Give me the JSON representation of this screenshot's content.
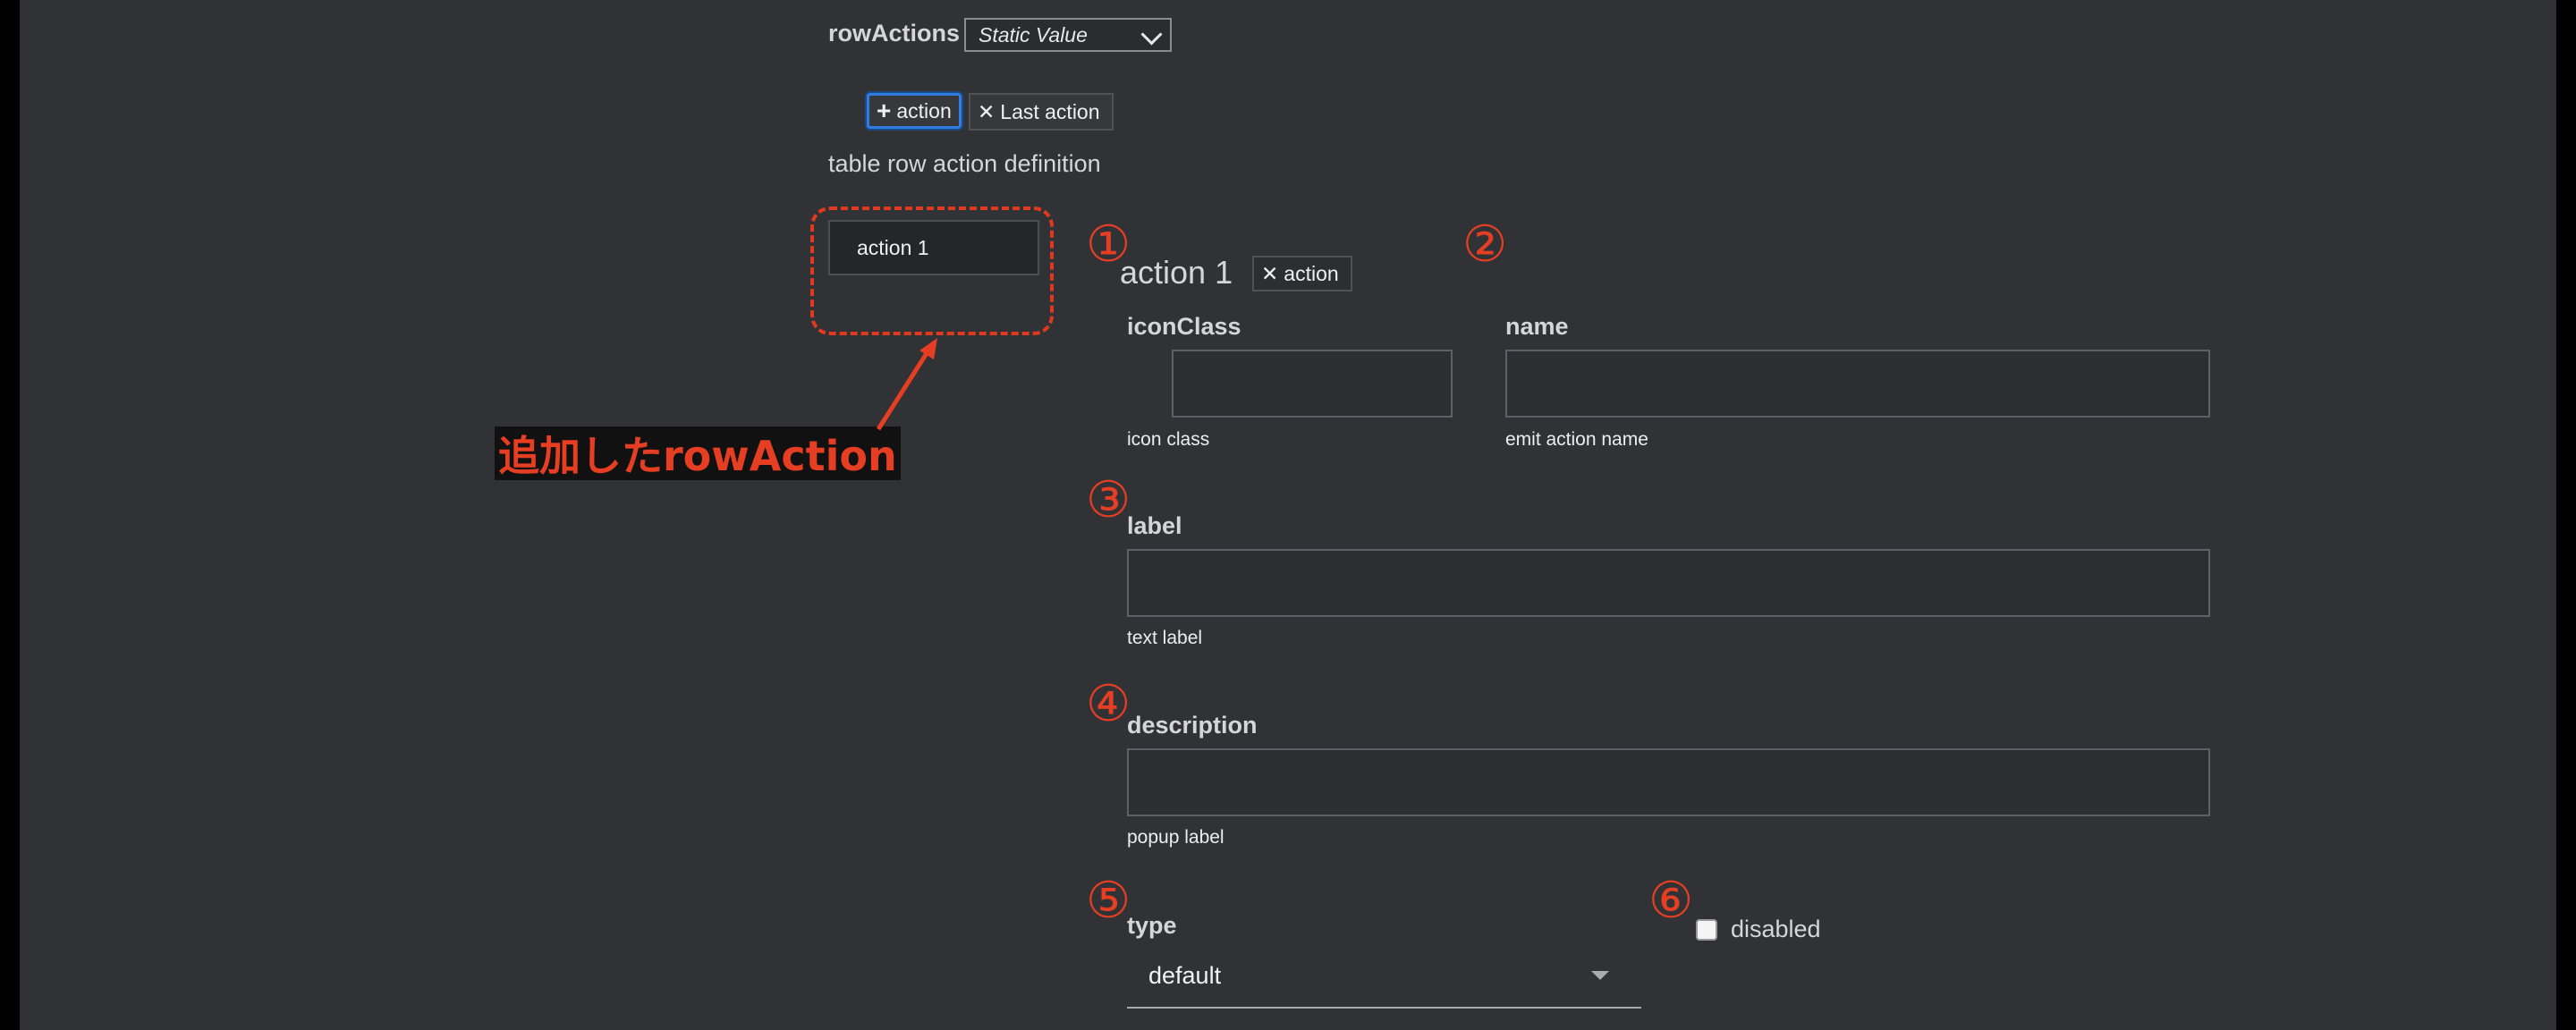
{
  "row_actions": {
    "label": "rowActions",
    "source_select": "Static Value",
    "add_button_label": "action",
    "remove_last_label": "Last action",
    "section_title": "table row action definition",
    "list_items": [
      "action 1"
    ]
  },
  "annotation": {
    "callout": "追加したrowAction",
    "markers": [
      "①",
      "②",
      "③",
      "④",
      "⑤",
      "⑥"
    ],
    "color": "#e53e23"
  },
  "action_editor": {
    "title": "action 1",
    "remove_button_label": "action",
    "fields": {
      "icon_class": {
        "label": "iconClass",
        "value": "",
        "hint": "icon class"
      },
      "name": {
        "label": "name",
        "value": "",
        "hint": "emit action name"
      },
      "label": {
        "label": "label",
        "value": "",
        "hint": "text label"
      },
      "description": {
        "label": "description",
        "value": "",
        "hint": "popup label"
      },
      "type": {
        "label": "type",
        "value": "default"
      },
      "disabled": {
        "label": "disabled",
        "checked": false
      }
    }
  },
  "colors": {
    "background": "#303236",
    "accent_focus": "#2f7dde",
    "annotation_red": "#e53e23"
  }
}
